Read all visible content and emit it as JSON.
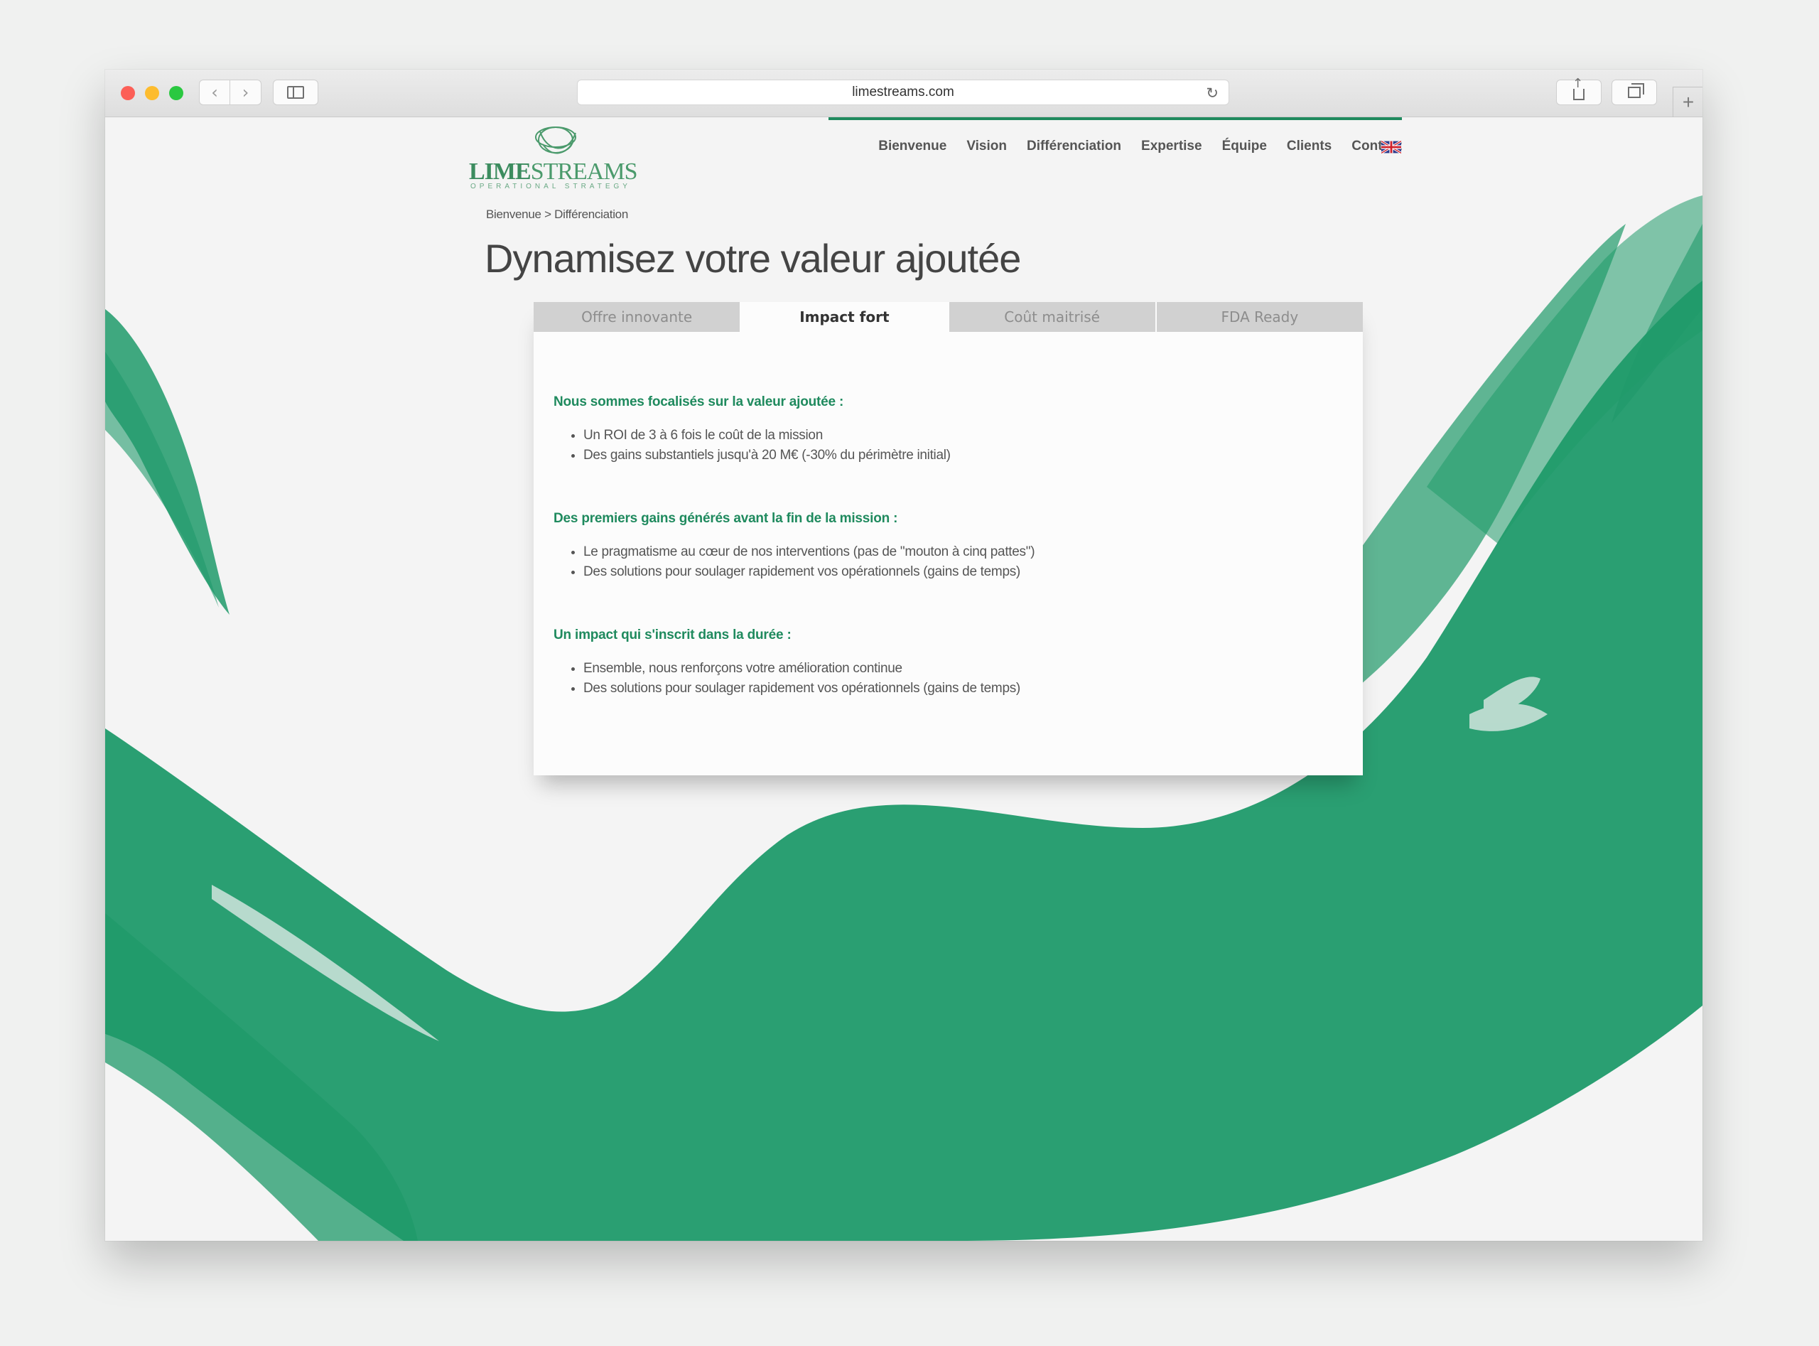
{
  "browser": {
    "url": "limestreams.com"
  },
  "logo": {
    "brand_bold": "LIME",
    "brand_light": "STREAMS",
    "tagline": "OPERATIONAL STRATEGY"
  },
  "nav": {
    "items": [
      "Bienvenue",
      "Vision",
      "Différenciation",
      "Expertise",
      "Équipe",
      "Clients",
      "Contact"
    ],
    "language_flag": "uk-flag-icon"
  },
  "breadcrumb": "Bienvenue > Différenciation",
  "page_title": "Dynamisez votre valeur ajoutée",
  "tabs": [
    {
      "label": "Offre innovante",
      "active": false
    },
    {
      "label": "Impact fort",
      "active": true
    },
    {
      "label": "Coût maitrisé",
      "active": false
    },
    {
      "label": "FDA Ready",
      "active": false
    }
  ],
  "sections": [
    {
      "heading": "Nous sommes focalisés sur la valeur ajoutée :",
      "items": [
        "Un ROI de 3 à 6 fois le coût de la mission",
        "Des gains substantiels jusqu'à 20 M€ (-30% du périmètre initial)"
      ]
    },
    {
      "heading": "Des premiers gains générés avant la fin de la mission :",
      "items": [
        "Le pragmatisme au cœur de nos interventions (pas de \"mouton à cinq pattes\")",
        "Des solutions pour soulager rapidement vos opérationnels (gains de temps)"
      ]
    },
    {
      "heading": "Un impact qui s'inscrit dans la durée :",
      "items": [
        "Ensemble, nous renforçons votre amélioration continue",
        "Des solutions pour soulager rapidement vos opérationnels (gains de temps)"
      ]
    }
  ],
  "colors": {
    "accent": "#1f8a5e",
    "brush": "#1f9a6a",
    "tab_inactive": "#d1d1d1"
  }
}
